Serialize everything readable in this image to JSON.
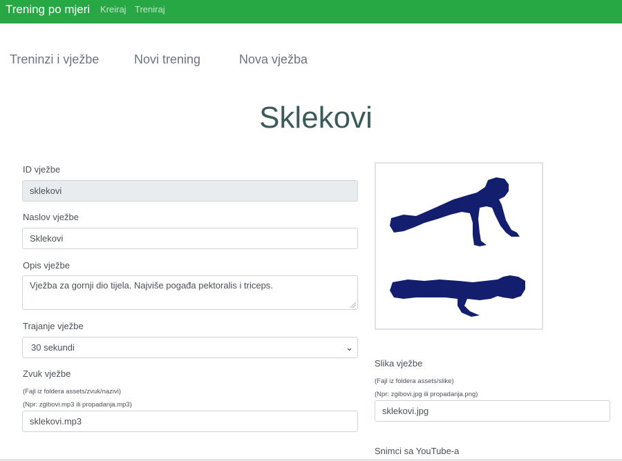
{
  "navbar": {
    "brand": "Trening po mjeri",
    "links": [
      "Kreiraj",
      "Treniraj"
    ],
    "color": "#28a745"
  },
  "tabs": [
    "Treninzi i vježbe",
    "Novi trening",
    "Nova vježba"
  ],
  "page": {
    "title": "Sklekovi"
  },
  "form": {
    "id": {
      "label": "ID vježbe",
      "value": "sklekovi"
    },
    "title": {
      "label": "Naslov vježbe",
      "value": "Sklekovi"
    },
    "description": {
      "label": "Opis vježbe",
      "value": "Vježba za gornji dio tijela. Najviše pogađa pektoralis i triceps."
    },
    "duration": {
      "label": "Trajanje vježbe",
      "selected": "30 sekundi"
    },
    "sound": {
      "label": "Zvuk vježbe",
      "hint1": "(Fajl iz foldera assets/zvuk/nazivi)",
      "hint2": "(Npr: zgibovi.mp3 ili propadanja.mp3)",
      "value": "sklekovi.mp3"
    },
    "image": {
      "label": "Slika vježbe",
      "hint1": "(Fajl iz foldera assets/slike)",
      "hint2": "(Npr: zgibovi.jpg ili propadanja.png)",
      "value": "sklekovi.jpg"
    },
    "youtube": {
      "label": "Snimci sa YouTube-a"
    }
  },
  "illustration": {
    "name": "pushup-illustration",
    "color": "#141e6e"
  }
}
